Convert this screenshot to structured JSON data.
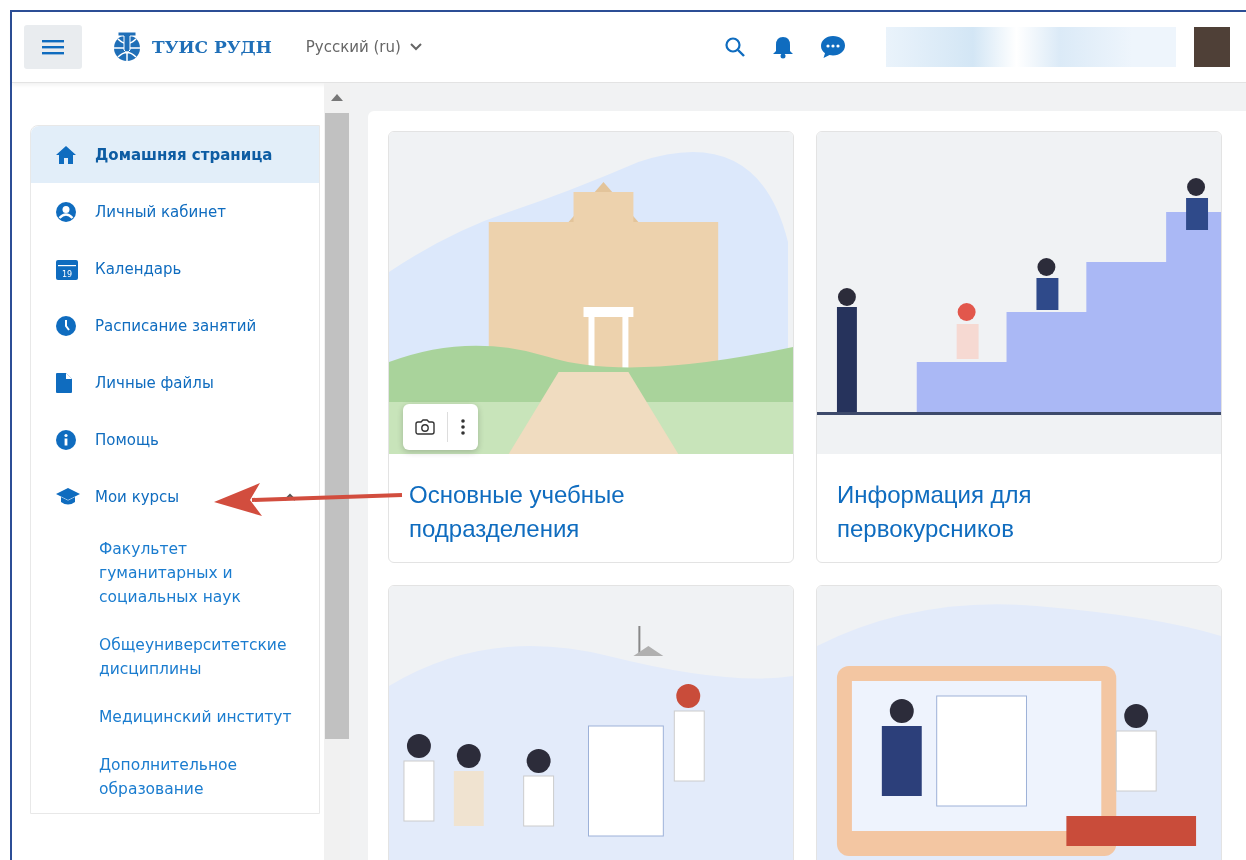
{
  "header": {
    "logo_text": "ТУИС РУДН",
    "language": "Русский (ru)"
  },
  "nav": [
    {
      "label": "Домашняя страница",
      "kind": "home",
      "selected": true
    },
    {
      "label": "Личный кабинет",
      "kind": "user",
      "selected": false
    },
    {
      "label": "Календарь",
      "kind": "calendar",
      "icon_text": "19",
      "selected": false
    },
    {
      "label": "Расписание занятий",
      "kind": "clock",
      "selected": false
    },
    {
      "label": "Личные файлы",
      "kind": "file",
      "selected": false
    },
    {
      "label": "Помощь",
      "kind": "info",
      "selected": false
    },
    {
      "label": "Мои курсы",
      "kind": "cap",
      "selected": false,
      "expanded": true,
      "children": [
        {
          "label": "Факультет гуманитарных и социальных наук"
        },
        {
          "label": "Общеуниверситетские дисциплины"
        },
        {
          "label": "Медицинский институт"
        },
        {
          "label": "Дополнительное образование"
        }
      ]
    }
  ],
  "cards": [
    {
      "title": "Основные учебные подразделения",
      "kind": "campus",
      "edit_controls": true
    },
    {
      "title": "Информация для первокурсников",
      "kind": "stairs",
      "edit_controls": false
    },
    {
      "kind": "meeting"
    },
    {
      "kind": "computer"
    }
  ]
}
